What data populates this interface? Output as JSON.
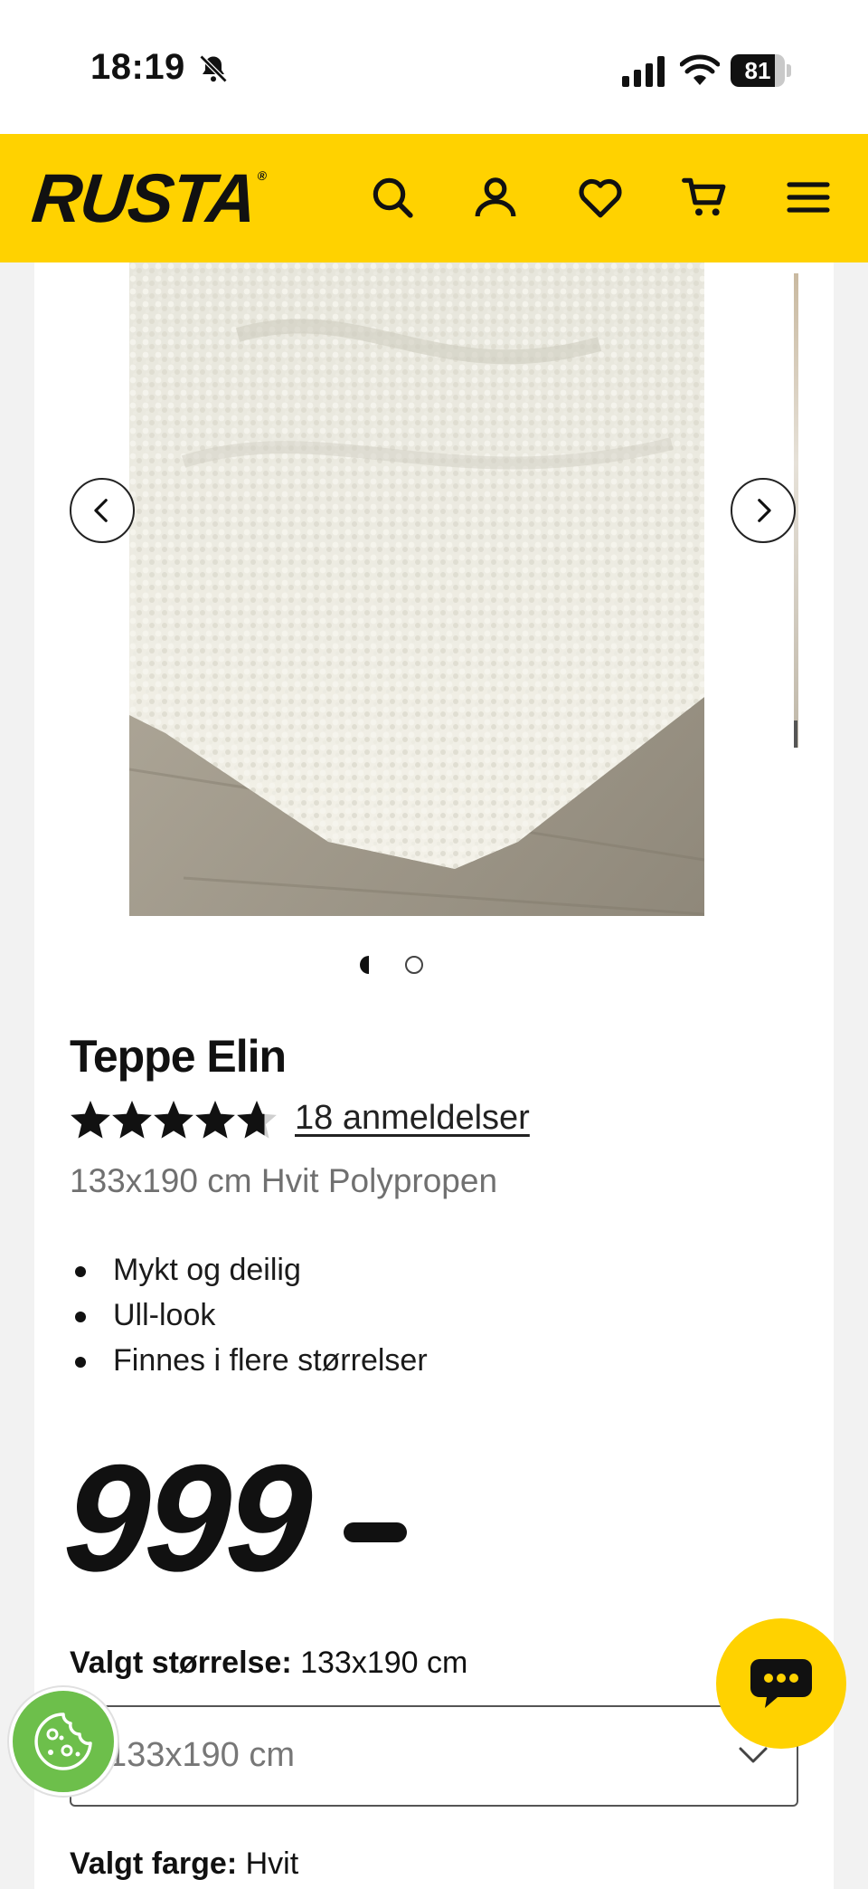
{
  "status_bar": {
    "time": "18:19",
    "battery_level": "81",
    "battery_fraction": 0.81,
    "icons": [
      "bell-slash-icon",
      "cellular-signal-icon",
      "wifi-icon",
      "battery-icon"
    ]
  },
  "header": {
    "logo": "RUSTA",
    "background_color": "#ffd200",
    "icons": [
      "search-icon",
      "user-icon",
      "heart-icon",
      "cart-icon",
      "menu-icon"
    ]
  },
  "gallery": {
    "image_description": "white shaggy rug corner on wooden floor",
    "prev_icon": "chevron-left-icon",
    "next_icon": "chevron-right-icon",
    "total_images": 2,
    "active_index": 1
  },
  "product": {
    "title": "Teppe Elin",
    "rating": 4.7,
    "rating_max": 5,
    "reviews_text": "18 anmeldelser",
    "subtitle": "133x190 cm Hvit Polypropen",
    "features": [
      "Mykt og deilig",
      "Ull-look",
      "Finnes i flere størrelser"
    ],
    "price": "999"
  },
  "options": {
    "size_label": "Valgt størrelse:",
    "size_value": "133x190 cm",
    "size_select_value": "133x190 cm",
    "color_label": "Valgt farge:",
    "color_value": "Hvit"
  },
  "floating": {
    "chat_icon": "chat-bubble-icon",
    "cookie_icon": "cookie-icon"
  }
}
